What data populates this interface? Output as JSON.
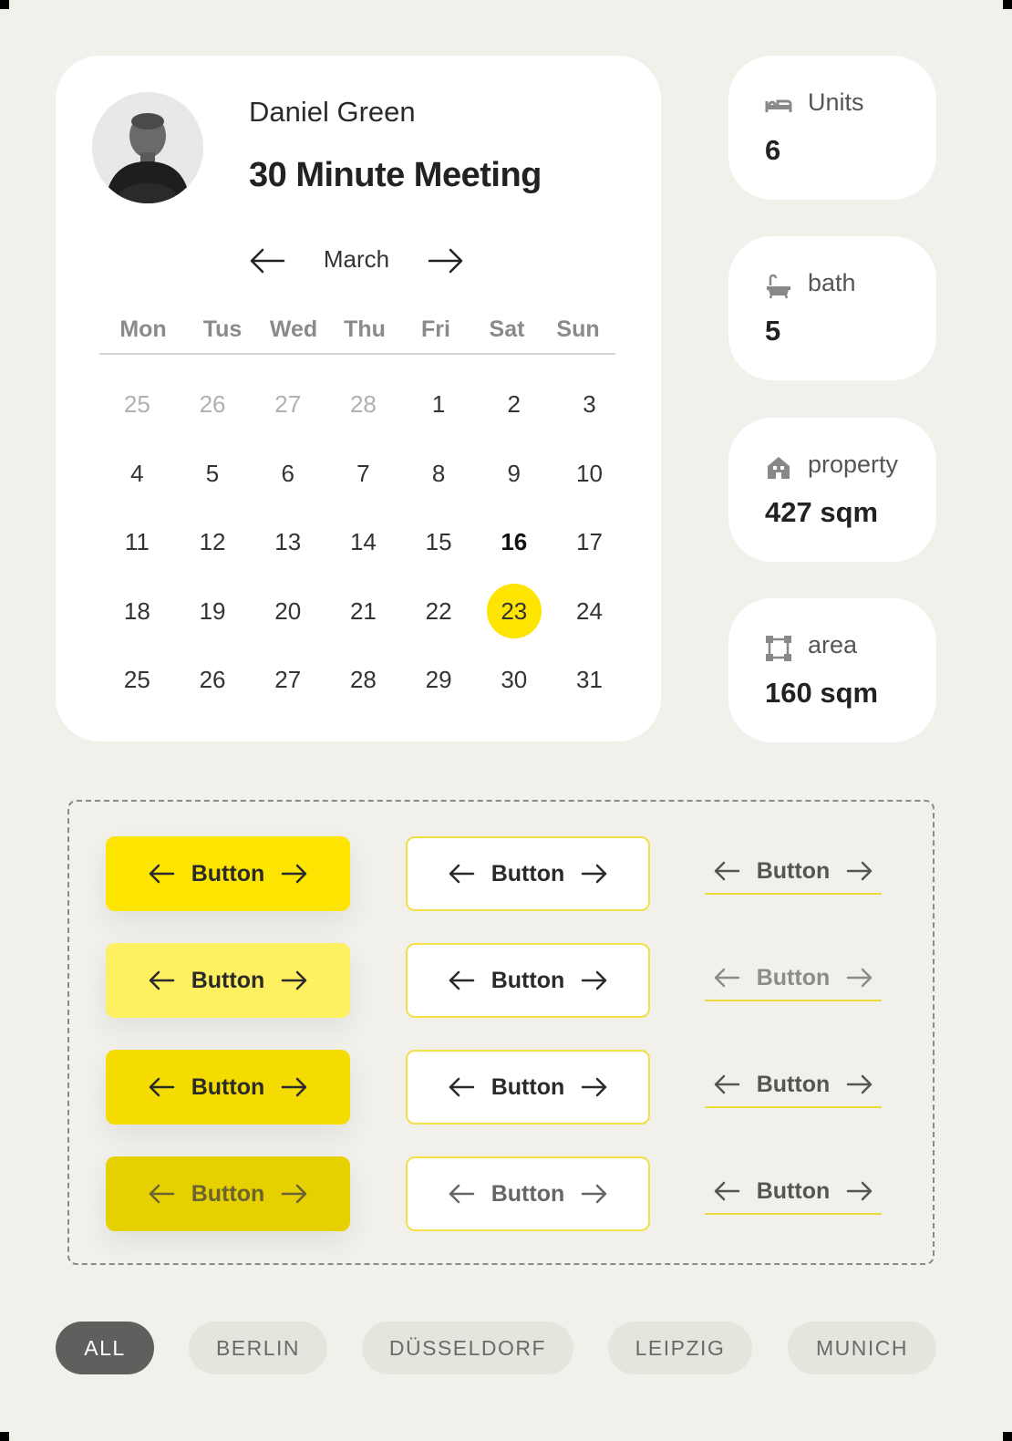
{
  "profile": {
    "name": "Daniel Green",
    "meeting_title": "30 Minute Meeting"
  },
  "calendar": {
    "month": "March",
    "weekdays": [
      "Mon",
      "Tus",
      "Wed",
      "Thu",
      "Fri",
      "Sat",
      "Sun"
    ],
    "days": [
      {
        "label": "25",
        "state": "muted"
      },
      {
        "label": "26",
        "state": "muted"
      },
      {
        "label": "27",
        "state": "muted"
      },
      {
        "label": "28",
        "state": "muted"
      },
      {
        "label": "1"
      },
      {
        "label": "2"
      },
      {
        "label": "3"
      },
      {
        "label": "4"
      },
      {
        "label": "5"
      },
      {
        "label": "6"
      },
      {
        "label": "7"
      },
      {
        "label": "8"
      },
      {
        "label": "9"
      },
      {
        "label": "10"
      },
      {
        "label": "11"
      },
      {
        "label": "12"
      },
      {
        "label": "13"
      },
      {
        "label": "14"
      },
      {
        "label": "15"
      },
      {
        "label": "16",
        "state": "today"
      },
      {
        "label": "17"
      },
      {
        "label": "18"
      },
      {
        "label": "19"
      },
      {
        "label": "20"
      },
      {
        "label": "21"
      },
      {
        "label": "22"
      },
      {
        "label": "23",
        "state": "selected"
      },
      {
        "label": "24"
      },
      {
        "label": "25"
      },
      {
        "label": "26"
      },
      {
        "label": "27"
      },
      {
        "label": "28"
      },
      {
        "label": "29"
      },
      {
        "label": "30"
      },
      {
        "label": "31"
      }
    ],
    "selected_color": "#fde501"
  },
  "stats": [
    {
      "icon": "bed-icon",
      "label": "Units",
      "value": "6"
    },
    {
      "icon": "bathtub-icon",
      "label": "bath",
      "value": "5"
    },
    {
      "icon": "house-icon",
      "label": "property",
      "value": "427 sqm"
    },
    {
      "icon": "area-icon",
      "label": "area",
      "value": "160 sqm"
    }
  ],
  "buttons": {
    "label": "Button",
    "solid_colors": [
      "#fde501",
      "#fff062",
      "#f5dc00",
      "#e6d000"
    ],
    "outline_border": "#f1e046",
    "link_underline": "#eadb3b",
    "states": [
      "default",
      "hover",
      "pressed",
      "disabled"
    ]
  },
  "filters": [
    {
      "label": "ALL",
      "active": true
    },
    {
      "label": "BERLIN"
    },
    {
      "label": "DÜSSELDORF"
    },
    {
      "label": "LEIPZIG"
    },
    {
      "label": "MUNICH"
    }
  ]
}
